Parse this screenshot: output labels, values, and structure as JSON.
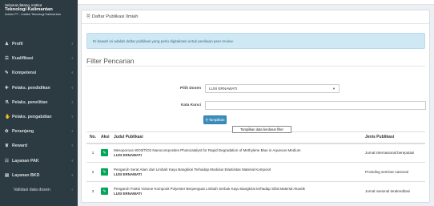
{
  "brand": {
    "line1": "Selamat datang, Institut",
    "line2": "Teknologi Kalimantan",
    "line3": "Admin PT - Institut Teknologi Kalimantan"
  },
  "sidebar": {
    "items": [
      {
        "icon": "user-icon",
        "glyph": "♟",
        "label": "Profil"
      },
      {
        "icon": "graduation-icon",
        "glyph": "☰",
        "label": "Kualifikasi"
      },
      {
        "icon": "wrench-icon",
        "glyph": "✎",
        "label": "Kompetensi"
      },
      {
        "icon": "teach-icon",
        "glyph": "✚",
        "label": "Pelaks. pendidikan"
      },
      {
        "icon": "flask-icon",
        "glyph": "⚗",
        "label": "Pelaks. penelitian"
      },
      {
        "icon": "handshake-icon",
        "glyph": "✋",
        "label": "Pelaks. pengabdian"
      },
      {
        "icon": "support-icon",
        "glyph": "✿",
        "label": "Penunjang"
      },
      {
        "icon": "trophy-icon",
        "glyph": "♛",
        "label": "Reward"
      },
      {
        "icon": "pak-icon",
        "glyph": "☷",
        "label": "Layanan PAK"
      },
      {
        "icon": "bkd-icon",
        "glyph": "▤",
        "label": "Layanan BKD"
      },
      {
        "icon": "",
        "glyph": "",
        "label": "Validasi data dosen"
      }
    ]
  },
  "card": {
    "title": "Daftar Publikasi Ilmiah",
    "alert": "Di bawah ini adalah daftar publikasi yang perlu digitalisasi untuk penilaian peer review."
  },
  "filter": {
    "title": "Filter Pencarian",
    "dosen_label": "Pilih Dosen",
    "dosen_value": "LUSI ERNAWATI",
    "kunci_label": "Kata Kunci",
    "kunci_value": "",
    "button_label": "Tampilkan",
    "tooltip": "Tampilkan data berdasar filter"
  },
  "table": {
    "headers": {
      "no": "No.",
      "aksi": "Aksi",
      "judul": "Judul Publikasi",
      "jenis": "Jenis Publikasi"
    },
    "rows": [
      {
        "no": "1",
        "judul": "Mesoporous WO3/TiO2 Nanocomposites Photocatalyst for Rapid Degradation of Methylene Blue in Aqueous Medium",
        "author": "LUSI ERNAWATI",
        "jenis": "Jurnal internasional bereputasi"
      },
      {
        "no": "2",
        "judul": "Pengaruh Serat Alam dari Limbah Kayu Bangkirai Terhadap Modulus Elastisitas Material Komposit",
        "author": "LUSI ERNAWATI",
        "jenis": "Prosiding seminar nasional"
      },
      {
        "no": "3",
        "judul": "Pengaruh Fraksi Volume Komposit Polyester Berpenguat Limbah Serbuk Kayu Bangkirai terhadap Sifat Material Akustik",
        "author": "LUSI ERNAWATI",
        "jenis": "Jurnal nasional terakreditasi"
      }
    ]
  }
}
